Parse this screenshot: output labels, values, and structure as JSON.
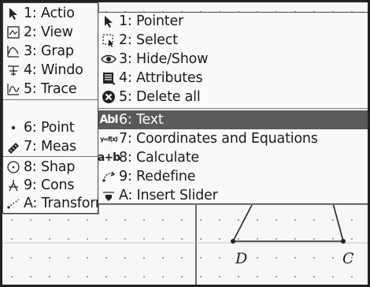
{
  "main_menu": {
    "items": [
      {
        "label": "1: Actio",
        "icon": "pointer-arrow-icon"
      },
      {
        "label": "2: View",
        "icon": "view-icon"
      },
      {
        "label": "3: Grap",
        "icon": "graph-type-icon"
      },
      {
        "label": "4: Windo",
        "icon": "window-zoom-icon"
      },
      {
        "label": "5: Trace",
        "icon": "trace-icon"
      },
      {
        "label": "6: Point",
        "icon": "point-icon"
      },
      {
        "label": "7: Meas",
        "icon": "measurement-ruler-icon"
      },
      {
        "label": "8: Shap",
        "icon": "shapes-icon"
      },
      {
        "label": "9: Cons",
        "icon": "construction-icon"
      },
      {
        "label": "A: Transformation",
        "icon": "transformation-icon"
      }
    ]
  },
  "sub_menu": {
    "items": [
      {
        "label": "1: Pointer",
        "icon": "pointer-arrow-icon",
        "icon_glyph": "▲"
      },
      {
        "label": "2: Select",
        "icon": "select-icon",
        "icon_glyph": "⬚"
      },
      {
        "label": "3: Hide/Show",
        "icon": "eye-icon",
        "icon_glyph": "◉"
      },
      {
        "label": "4: Attributes",
        "icon": "attributes-icon",
        "icon_glyph": "≡"
      },
      {
        "label": "5: Delete all",
        "icon": "delete-all-icon",
        "icon_glyph": "✖"
      },
      {
        "label": "6: Text",
        "icon": "text-icon",
        "icon_glyph": "AbI",
        "selected": true
      },
      {
        "label": "7: Coordinates and Equations",
        "icon": "coordinates-equations-icon",
        "icon_glyph": "y=f(x)"
      },
      {
        "label": "8: Calculate",
        "icon": "calculate-icon",
        "icon_glyph": "a+b"
      },
      {
        "label": "9: Redefine",
        "icon": "redefine-icon",
        "icon_glyph": "⤴"
      },
      {
        "label": "A: Insert Slider",
        "icon": "slider-icon",
        "icon_glyph": "⬇"
      }
    ]
  },
  "canvas": {
    "point_labels": [
      "D",
      "C"
    ]
  },
  "colors": {
    "highlight": "#5a5a5a",
    "menu_bg": "#fafafa",
    "canvas_bg": "#f7f7f7"
  }
}
